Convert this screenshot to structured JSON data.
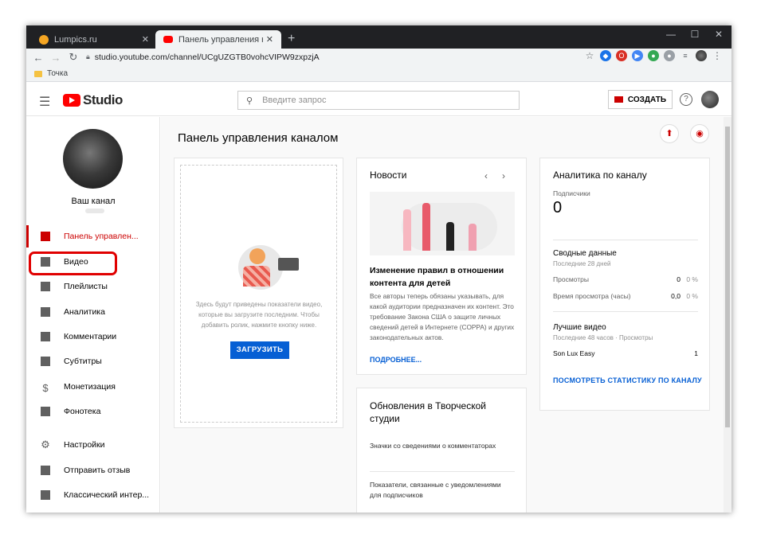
{
  "browser": {
    "tabs": [
      {
        "title": "Lumpics.ru"
      },
      {
        "title": "Панель управления каналом - Y"
      }
    ],
    "url": "studio.youtube.com/channel/UCgUZGTB0vohcVIPW9zxpzjA",
    "bookmark": "Точка"
  },
  "header": {
    "logo": "Studio",
    "search_placeholder": "Введите запрос",
    "create_label": "СОЗДАТЬ",
    "help": "?"
  },
  "sidebar": {
    "channel_name": "Ваш канал",
    "items": [
      {
        "label": "Панель управлен...",
        "icon": "dashboard-icon"
      },
      {
        "label": "Видео",
        "icon": "video-icon"
      },
      {
        "label": "Плейлисты",
        "icon": "playlist-icon"
      },
      {
        "label": "Аналитика",
        "icon": "analytics-icon"
      },
      {
        "label": "Комментарии",
        "icon": "comments-icon"
      },
      {
        "label": "Субтитры",
        "icon": "subtitles-icon"
      },
      {
        "label": "Монетизация",
        "icon": "dollar-icon"
      },
      {
        "label": "Фонотека",
        "icon": "music-library-icon"
      },
      {
        "label": "Настройки",
        "icon": "gear-icon"
      },
      {
        "label": "Отправить отзыв",
        "icon": "feedback-icon"
      },
      {
        "label": "Классический интер...",
        "icon": "exit-icon"
      }
    ]
  },
  "main": {
    "title": "Панель управления каналом",
    "upload_card": {
      "text": "Здесь будут приведены показатели видео, которые вы загрузите последним. Чтобы добавить ролик, нажмите кнопку ниже.",
      "button": "ЗАГРУЗИТЬ"
    },
    "news": {
      "title": "Новости",
      "headline": "Изменение правил в отношении контента для детей",
      "body": "Все авторы теперь обязаны указывать, для какой аудитории предназначен их контент. Это требование Закона США о защите личных сведений детей в Интернете (COPPA) и других законодательных актов.",
      "link": "ПОДРОБНЕЕ..."
    },
    "updates": {
      "title": "Обновления в Творческой студии",
      "item1": "Значки со сведениями о комментаторах",
      "item2": "Показатели, связанные с уведомлениями для подписчиков"
    },
    "analytics": {
      "title": "Аналитика по каналу",
      "subs_label": "Подписчики",
      "subs_value": "0",
      "summary_title": "Сводные данные",
      "summary_period": "Последние 28 дней",
      "views_label": "Просмотры",
      "views_value": "0",
      "views_pct": "0 %",
      "watch_label": "Время просмотра (часы)",
      "watch_value": "0,0",
      "watch_pct": "0 %",
      "top_title": "Лучшие видео",
      "top_period": "Последние 48 часов · Просмотры",
      "top_video": "Son Lux Easy",
      "top_views": "1",
      "link": "ПОСМОТРЕТЬ СТАТИСТИКУ ПО КАНАЛУ"
    }
  }
}
